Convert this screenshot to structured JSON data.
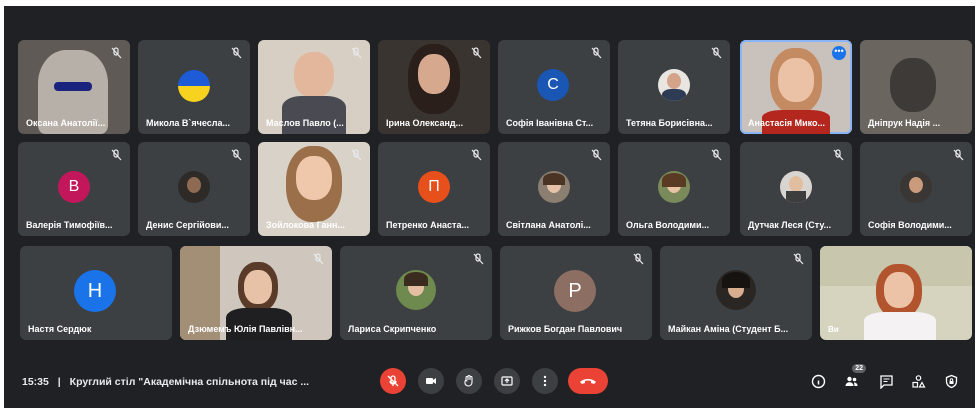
{
  "colors": {
    "background": "#202124",
    "tile": "#3c4043",
    "accent_blue": "#1a73e8",
    "hangup_red": "#ea4335"
  },
  "row1": [
    {
      "name": "Оксана Анатолії...",
      "kind": "video"
    },
    {
      "name": "Микола В`ячесла...",
      "kind": "flag-avatar"
    },
    {
      "name": "Маслов Павло (...",
      "kind": "video"
    },
    {
      "name": "Ірина Олександ...",
      "kind": "video"
    },
    {
      "name": "Софія Іванівна Ст...",
      "kind": "letter",
      "letter": "С",
      "color": "#1a56b3"
    },
    {
      "name": "Тетяна Борисівна...",
      "kind": "photo-avatar"
    },
    {
      "name": "Анастасія Мико...",
      "kind": "video-active"
    },
    {
      "name": "Дніпрук Надія ...",
      "kind": "video"
    }
  ],
  "row2": [
    {
      "name": "Валерія Тимофіїв...",
      "kind": "letter",
      "letter": "В",
      "color": "#c2185b"
    },
    {
      "name": "Денис Сергійови...",
      "kind": "photo-avatar"
    },
    {
      "name": "Зойлокова Ганн...",
      "kind": "video"
    },
    {
      "name": "Петренко Анаста...",
      "kind": "letter",
      "letter": "П",
      "color": "#e8501b"
    },
    {
      "name": "Світлана Анатолі...",
      "kind": "photo-avatar"
    },
    {
      "name": "Ольга Володими...",
      "kind": "photo-avatar"
    },
    {
      "name": "Дутчак Леся (Сту...",
      "kind": "photo-avatar"
    },
    {
      "name": "Софія Володими...",
      "kind": "photo-avatar"
    }
  ],
  "row3": [
    {
      "name": "Настя Сердюк",
      "kind": "letter",
      "letter": "Н",
      "color": "#1a73e8"
    },
    {
      "name": "Дзюмемъ Юлія Павлівн...",
      "kind": "video"
    },
    {
      "name": "Лариса Скрипченко",
      "kind": "photo-avatar"
    },
    {
      "name": "Рижков Богдан Павлович",
      "kind": "letter",
      "letter": "Р",
      "color": "#8d6e63"
    },
    {
      "name": "Майкан Аміна (Студент Б...",
      "kind": "photo-avatar"
    },
    {
      "name": "Ви",
      "kind": "video"
    }
  ],
  "meeting": {
    "time": "15:35",
    "separator": "|",
    "title": "Круглий стіл \"Академічна спільнота під час ..."
  },
  "controls": {
    "mic": "mic-off-icon",
    "camera": "camera-icon",
    "hand": "raise-hand-icon",
    "present": "present-icon",
    "more": "more-options-icon",
    "hangup": "hangup-icon"
  },
  "right_controls": {
    "participants_count": "22"
  }
}
